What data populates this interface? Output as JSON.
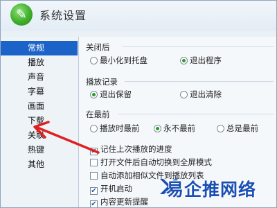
{
  "window": {
    "title": "系统设置",
    "app_icon": "wrench-icon"
  },
  "sidebar": {
    "items": [
      {
        "label": "常规",
        "selected": true
      },
      {
        "label": "播放",
        "selected": false
      },
      {
        "label": "声音",
        "selected": false
      },
      {
        "label": "字幕",
        "selected": false
      },
      {
        "label": "画面",
        "selected": false
      },
      {
        "label": "下载",
        "selected": false
      },
      {
        "label": "关联",
        "selected": false
      },
      {
        "label": "热键",
        "selected": false
      },
      {
        "label": "其他",
        "selected": false
      }
    ]
  },
  "sections": {
    "close": {
      "title": "关闭后",
      "options": [
        {
          "label": "最小化到托盘",
          "checked": false
        },
        {
          "label": "退出程序",
          "checked": true
        }
      ]
    },
    "history": {
      "title": "播放记录",
      "options": [
        {
          "label": "退出保留",
          "checked": true
        },
        {
          "label": "退出清除",
          "checked": false
        }
      ]
    },
    "ontop": {
      "title": "在最前",
      "options": [
        {
          "label": "播放时最前",
          "checked": false
        },
        {
          "label": "永不最前",
          "checked": true
        },
        {
          "label": "总是最前",
          "checked": false
        }
      ]
    }
  },
  "checkboxes": [
    {
      "label": "记住上次播放的进度",
      "checked": true
    },
    {
      "label": "打开文件后自动切换到全屏模式",
      "checked": false
    },
    {
      "label": "自动添加相似文件到播放列表",
      "checked": false
    },
    {
      "label": "开机启动",
      "checked": true
    },
    {
      "label": "内容更新提醒",
      "checked": true
    }
  ],
  "watermark": {
    "text": "易企推网络"
  },
  "colors": {
    "selection": "#1c63c9",
    "arrow": "#e02020",
    "radio_on": "#2b9a2b"
  }
}
